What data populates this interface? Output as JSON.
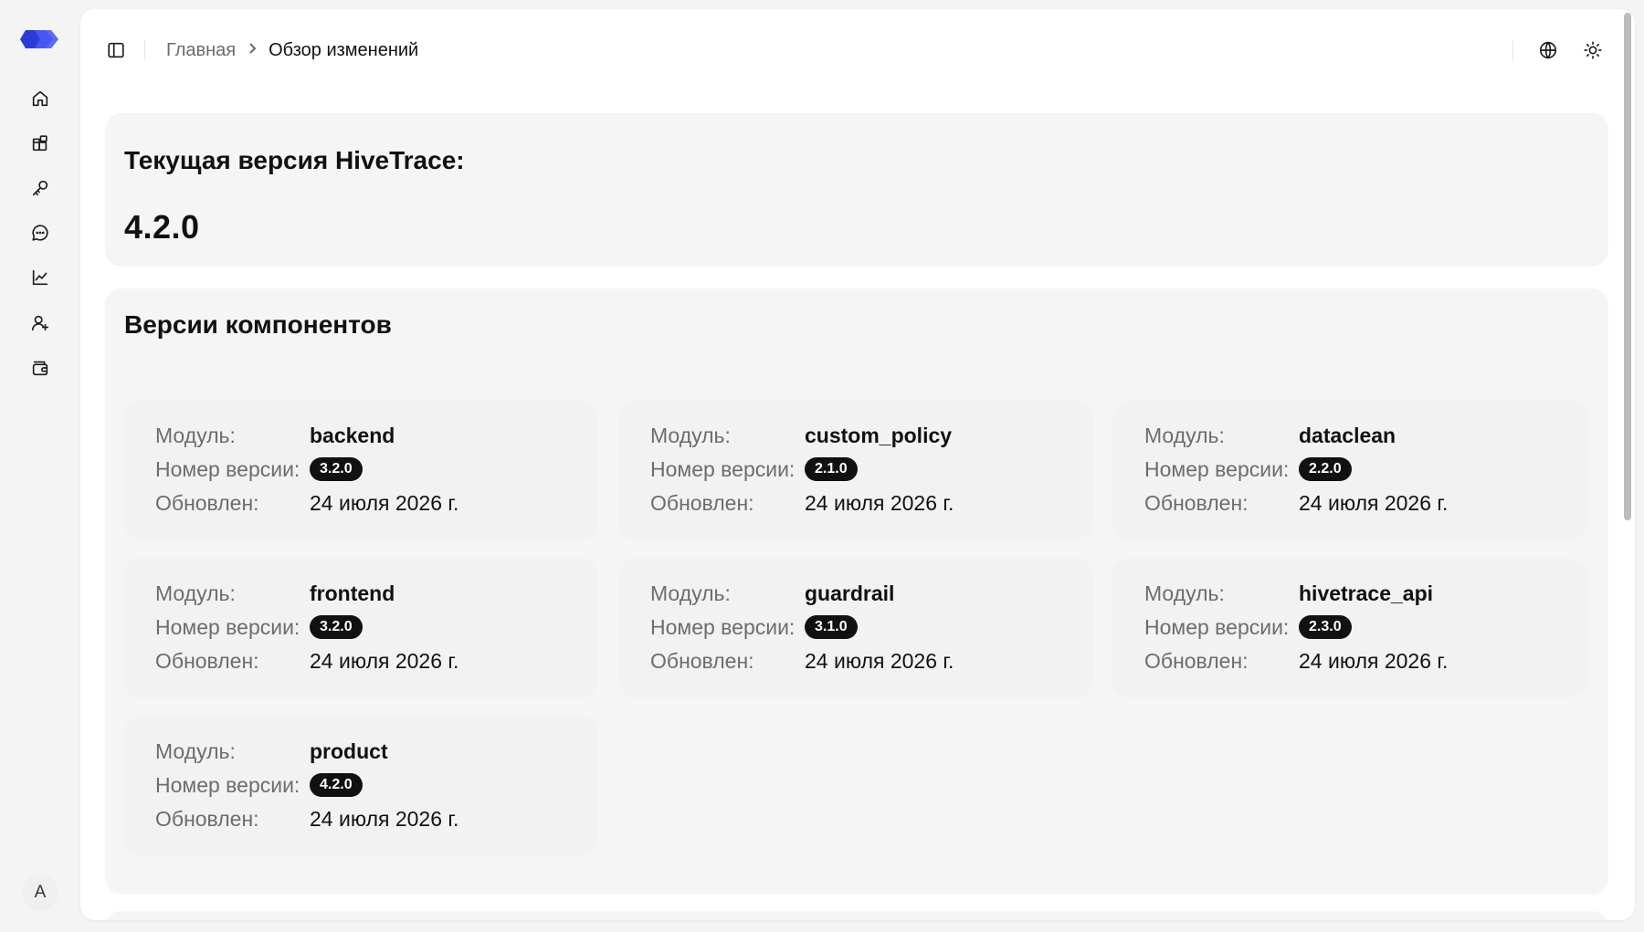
{
  "brand": {
    "logo_icon": "logo-icon",
    "accent": "#3b4bf0"
  },
  "sidebar": {
    "items": [
      {
        "name": "sidebar-item-home",
        "icon": "home-icon"
      },
      {
        "name": "sidebar-item-modules",
        "icon": "blocks-icon"
      },
      {
        "name": "sidebar-item-keys",
        "icon": "key-icon"
      },
      {
        "name": "sidebar-item-messages",
        "icon": "chat-icon"
      },
      {
        "name": "sidebar-item-analytics",
        "icon": "chart-icon"
      },
      {
        "name": "sidebar-item-add-user",
        "icon": "user-plus-icon"
      },
      {
        "name": "sidebar-item-wallet",
        "icon": "wallet-icon"
      }
    ],
    "avatar_initial": "A"
  },
  "header": {
    "breadcrumb": {
      "home": "Главная",
      "current": "Обзор изменений"
    },
    "icons": [
      "sidebar-toggle-icon",
      "globe-icon",
      "sun-icon"
    ]
  },
  "current_version": {
    "title": "Текущая версия HiveTrace:",
    "value": "4.2.0"
  },
  "components": {
    "title": "Версии компонентов",
    "labels": {
      "module": "Модуль:",
      "version": "Номер версии:",
      "updated": "Обновлен:"
    },
    "items": [
      {
        "module": "backend",
        "version": "3.2.0",
        "updated": "24 июля 2026 г."
      },
      {
        "module": "custom_policy",
        "version": "2.1.0",
        "updated": "24 июля 2026 г."
      },
      {
        "module": "dataclean",
        "version": "2.2.0",
        "updated": "24 июля 2026 г."
      },
      {
        "module": "frontend",
        "version": "3.2.0",
        "updated": "24 июля 2026 г."
      },
      {
        "module": "guardrail",
        "version": "3.1.0",
        "updated": "24 июля 2026 г."
      },
      {
        "module": "hivetrace_api",
        "version": "2.3.0",
        "updated": "24 июля 2026 г."
      },
      {
        "module": "product",
        "version": "4.2.0",
        "updated": "24 июля 2026 г."
      }
    ]
  }
}
